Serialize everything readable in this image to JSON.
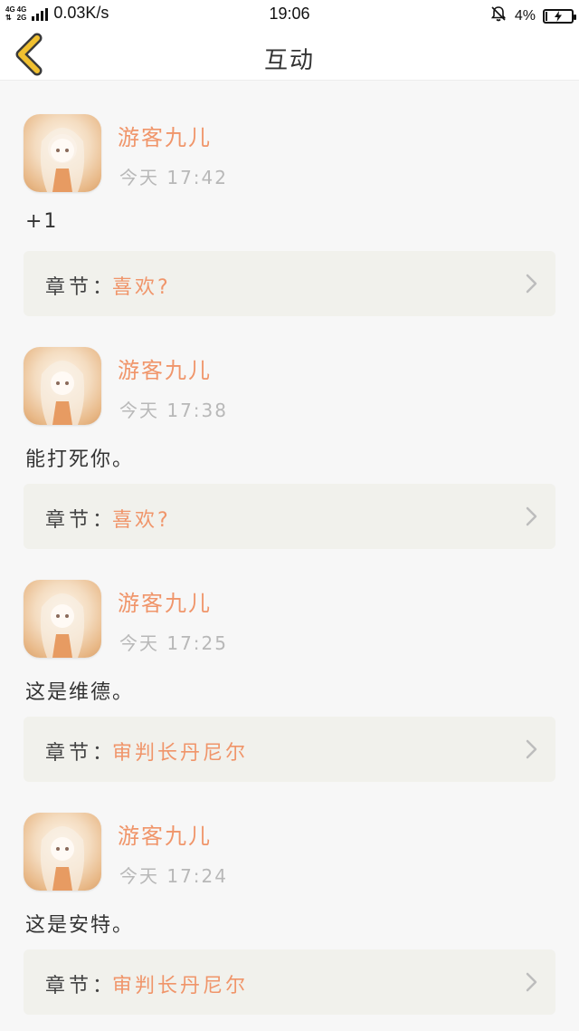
{
  "status_bar": {
    "net_labels": [
      "4G",
      "4G",
      "⇅",
      "2G"
    ],
    "speed": "0.03K/s",
    "time": "19:06",
    "battery_percent": "4%",
    "battery_level": 0.04
  },
  "header": {
    "title": "互动",
    "back_icon": "chevron-left-icon",
    "accent_color": "#f0c030"
  },
  "feed": [
    {
      "username": "游客九儿",
      "time": "今天 17:42",
      "text": "+1",
      "chapter_label": "章节：",
      "chapter_name": "喜欢?"
    },
    {
      "username": "游客九儿",
      "time": "今天 17:38",
      "text": "能打死你。",
      "chapter_label": "章节：",
      "chapter_name": "喜欢?"
    },
    {
      "username": "游客九儿",
      "time": "今天 17:25",
      "text": "这是维德。",
      "chapter_label": "章节：",
      "chapter_name": "审判长丹尼尔"
    },
    {
      "username": "游客九儿",
      "time": "今天 17:24",
      "text": "这是安特。",
      "chapter_label": "章节：",
      "chapter_name": "审判长丹尼尔"
    }
  ],
  "colors": {
    "username": "#f0956a",
    "chapter_name": "#f0956a",
    "timestamp": "#b8b8b8",
    "chapter_bg": "#f1f1ec"
  }
}
